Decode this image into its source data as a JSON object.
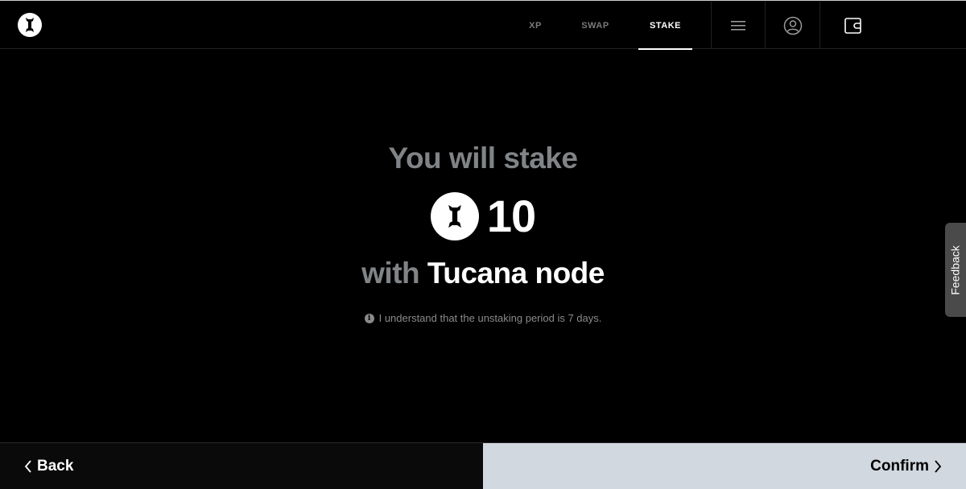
{
  "header": {
    "logo_icon": "bone-logo-icon",
    "nav": [
      {
        "label": "XP",
        "active": false
      },
      {
        "label": "SWAP",
        "active": false
      },
      {
        "label": "STAKE",
        "active": true
      }
    ],
    "icons": [
      "menu-icon",
      "user-icon",
      "wallet-icon"
    ]
  },
  "main": {
    "title": "You will stake",
    "token_icon": "bone-token-icon",
    "amount": "10",
    "node_prefix": "with",
    "node_name": "Tucana node",
    "notice_icon": "info-icon",
    "notice": "I understand that the unstaking period is 7 days."
  },
  "feedback": {
    "label": "Feedback"
  },
  "footer": {
    "back_label": "Back",
    "confirm_label": "Confirm"
  },
  "colors": {
    "background": "#000000",
    "muted_text": "#808487",
    "confirm_bg": "#d1d8df",
    "feedback_bg": "#4a4a4a"
  }
}
